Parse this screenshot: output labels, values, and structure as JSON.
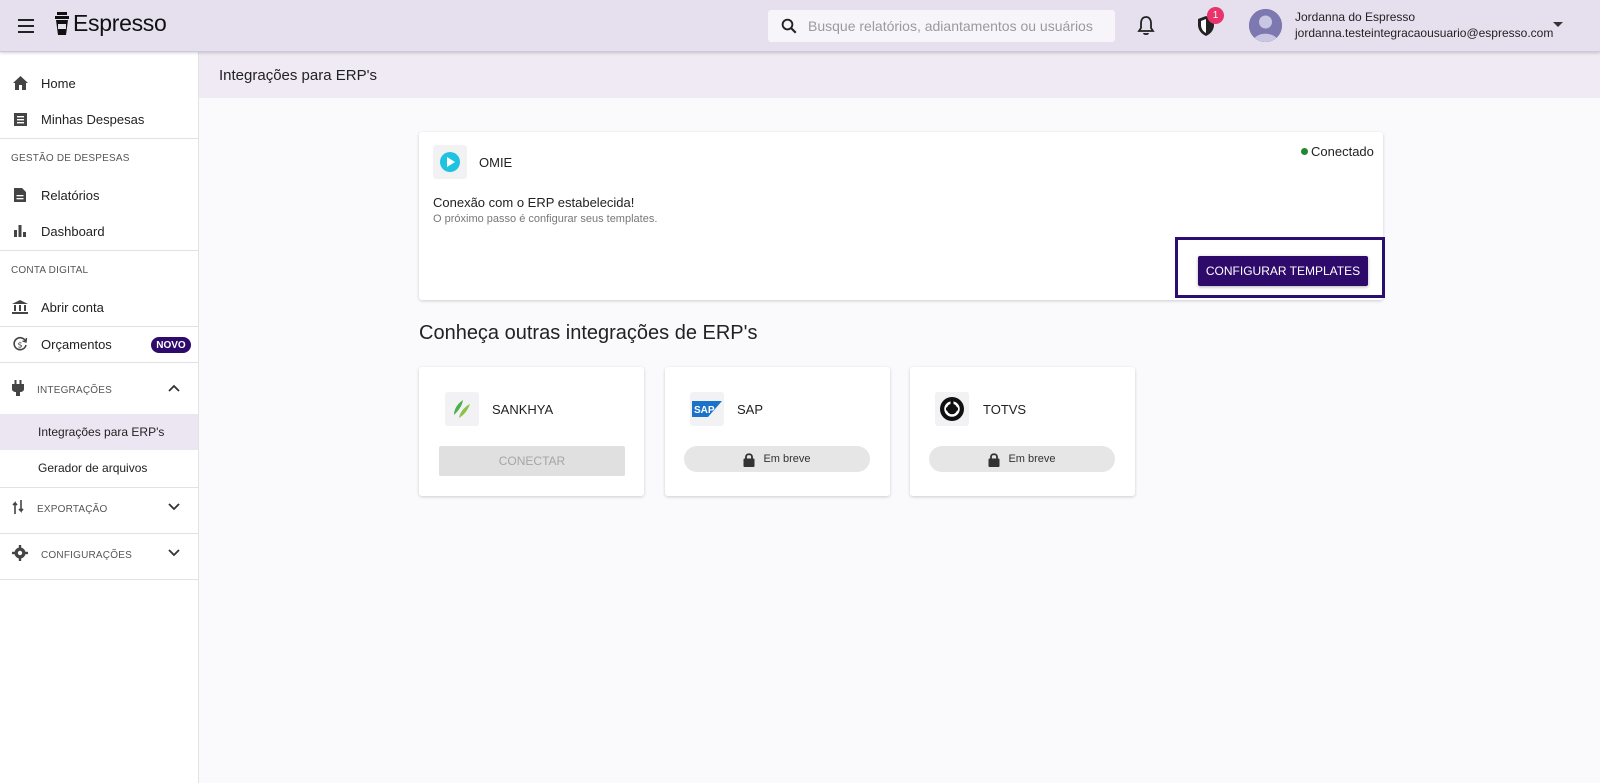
{
  "app": {
    "name": "Espresso"
  },
  "search": {
    "placeholder": "Busque relatórios, adiantamentos ou usuários"
  },
  "notifications": {
    "badge_count": "1"
  },
  "user": {
    "name": "Jordanna do Espresso",
    "email": "jordanna.testeintegracaousuario@espresso.com"
  },
  "sidebar": {
    "home": "Home",
    "minhas_despesas": "Minhas Despesas",
    "section_gestao": "GESTÃO DE DESPESAS",
    "relatorios": "Relatórios",
    "dashboard": "Dashboard",
    "section_conta": "CONTA DIGITAL",
    "abrir_conta": "Abrir conta",
    "orcamentos": "Orçamentos",
    "novo_badge": "NOVO",
    "integracoes": "INTEGRAÇÕES",
    "integracoes_erp": "Integrações para ERP's",
    "gerador": "Gerador de arquivos",
    "exportacao": "EXPORTAÇÃO",
    "configuracoes": "CONFIGURAÇÕES"
  },
  "page": {
    "title": "Integrações para ERP's"
  },
  "connected_erp": {
    "name": "OMIE",
    "status": "Conectado",
    "message_title": "Conexão com o ERP estabelecida!",
    "message_sub": "O próximo passo é configurar seus templates.",
    "button": "CONFIGURAR TEMPLATES"
  },
  "others": {
    "title": "Conheça outras integrações de ERP's",
    "items": [
      {
        "name": "SANKHYA",
        "action": "CONECTAR"
      },
      {
        "name": "SAP",
        "action": "Em breve"
      },
      {
        "name": "TOTVS",
        "action": "Em breve"
      }
    ]
  },
  "colors": {
    "accent": "#2e0b6b",
    "topbar": "#e6e0ee",
    "status_green": "#1d8a2f",
    "badge_pink": "#e8336b"
  }
}
